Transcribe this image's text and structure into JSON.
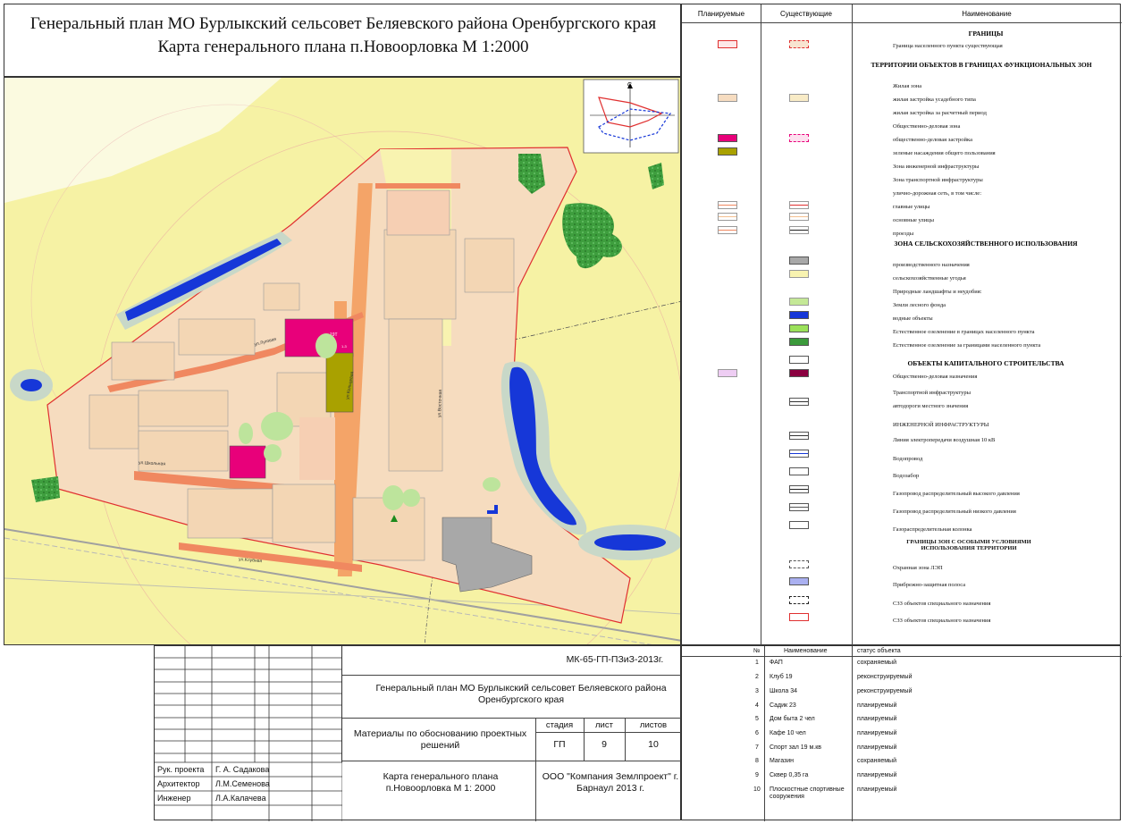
{
  "title": {
    "line1": "Генеральный план МО Бурлыкский сельсовет Беляевского района Оренбургского края",
    "line2": "Карта генерального плана п.Новоорловка М 1:2000"
  },
  "map": {
    "streets": [
      "ул.Луговая",
      "ул.Школьная",
      "ул.Клубная",
      "ул.Восточная",
      "ул.Кольцевая"
    ],
    "compass_label": "С",
    "building_labels": [
      "19Т",
      "1-3"
    ]
  },
  "legend": {
    "headers": {
      "planned": "Планируемые",
      "existing": "Существующие",
      "name": "Наименование"
    },
    "sections": {
      "borders": "ГРАНИЦЫ",
      "territories": "ТЕРРИТОРИИ ОБЪЕКТОВ В ГРАНИЦАХ ФУНКЦИОНАЛЬНЫХ ЗОН",
      "agri": "ЗОНА СЕЛЬСКОХОЗЯЙСТВЕННОГО ИСПОЛЬЗОВАНИЯ",
      "capital": "ОБЪЕКТЫ КАПИТАЛЬНОГО СТРОИТЕЛЬСТВА",
      "engineering": "ИНЖЕНЕРНОЙ ИНФРАСТРУКТУРЫ",
      "special": "ГРАНИЦЫ ЗОН С ОСОБЫМИ УСЛОВИЯМИ ИСПОЛЬЗОВАНИЯ ТЕРРИТОРИИ"
    },
    "items": [
      "Граница населенного пункта существующая",
      "Жилая зона",
      "жилая застройка усадебного типа",
      "жилая застройка за расчетный период",
      "Общественно-деловая зона",
      "общественно-деловая застройка",
      "зеленые насаждения общего пользования",
      "Зона инженерной инфраструктуры",
      "Зона транспортной инфраструктуры",
      "улично-дорожная сеть, в том числе:",
      "главные улицы",
      "основные улицы",
      "проезды",
      "производственного назначения",
      "сельскохозяйственные угодья",
      "Природные ландшафты и неудобия:",
      "Земли лесного фонда",
      "водные объекты",
      "Естественное озеленение в границах населенного пункта",
      "Естественное озеленение за границами населенного пункта",
      "Общественно-деловая назначения",
      "Транспортной инфраструктуры",
      "автодороги местного значения",
      "Линия электропередачи воздушная 10 кВ",
      "Водопровод",
      "Водозабор",
      "Газопровод распределительный высокого давления",
      "Газопровод распределительный низкого давления",
      "Газораспределительная колонка",
      "Охранная зона ЛЭП",
      "Прибрежно-защитная полоса",
      "СЗЗ объектов специального назначения",
      "СЗЗ объектов специального назначения"
    ]
  },
  "stamp": {
    "code": "МК-65-ГП-ПЗиЗ-2013г.",
    "project_title": "Генеральный план МО Бурлыкский сельсовет Беляевского района Оренбургского края",
    "materials": "Материалы по обоснованию проектных решений",
    "stage_label": "стадия",
    "sheet_label": "лист",
    "sheets_label": "листов",
    "stage": "ГП",
    "sheet": "9",
    "sheets": "10",
    "roles": [
      {
        "role": "Рук. проекта",
        "name": "Г. А. Садакова"
      },
      {
        "role": "Архитектор",
        "name": "Л.М.Семенова"
      },
      {
        "role": "Инженер",
        "name": "Л.А.Калачева"
      }
    ],
    "map_title": "Карта генерального плана п.Новоорловка М 1: 2000",
    "company": "ООО \"Компания Землпроект\" г. Барнаул 2013 г."
  },
  "objects": {
    "headers": {
      "num": "№",
      "name": "Наименование",
      "status": "статус объекта"
    },
    "rows": [
      {
        "num": "1",
        "name": "ФАП",
        "status": "сохраняемый"
      },
      {
        "num": "2",
        "name": "Клуб 19",
        "status": "реконструируемый"
      },
      {
        "num": "3",
        "name": "Школа 34",
        "status": "реконструируемый"
      },
      {
        "num": "4",
        "name": "Садик 23",
        "status": "планируемый"
      },
      {
        "num": "5",
        "name": "Дом быта 2 чел",
        "status": "планируемый"
      },
      {
        "num": "6",
        "name": "Кафе 10 чел",
        "status": "планируемый"
      },
      {
        "num": "7",
        "name": "Спорт зал 19 м.кв",
        "status": "планируемый"
      },
      {
        "num": "8",
        "name": "Магазин",
        "status": "сохраняемый"
      },
      {
        "num": "9",
        "name": "Сквер 0,35 га",
        "status": "планируемый"
      },
      {
        "num": "10",
        "name": "Плоскостные спортивные сооружения",
        "status": "планируемый"
      }
    ]
  },
  "colors": {
    "field": "#f7f3a6",
    "residential": "#f6dcc0",
    "public": "#e8007a",
    "green": "#b9e39a",
    "forest": "#3b9a3b",
    "water": "#1637d8",
    "border_red": "#e03030",
    "production": "#a9a9a9",
    "olive": "#a8a000"
  }
}
